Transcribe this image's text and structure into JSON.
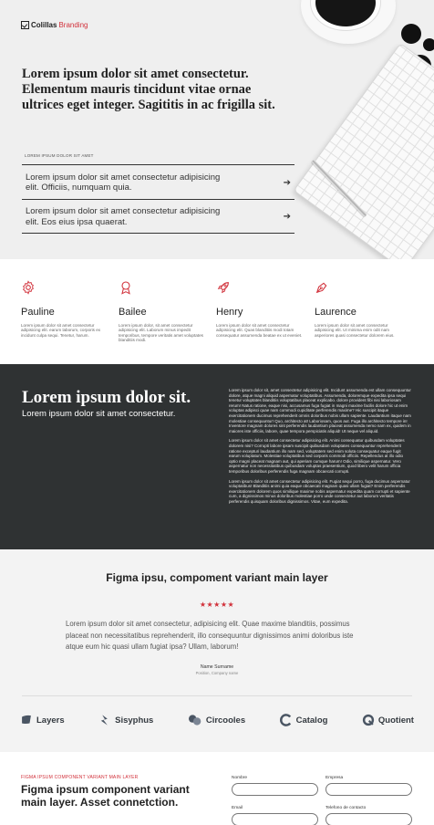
{
  "colors": {
    "accent": "#d1303a",
    "dark_section": "#2f3233",
    "light_bg": "#efefef"
  },
  "header": {
    "brand_part1": "Colillas",
    "brand_part2": "Branding"
  },
  "hero": {
    "title": "Lorem ipsum dolor sit amet consectetur. Elementum mauris tincidunt vitae ornae ultrices eget integer. Sagititis in ac frigilla sit.",
    "label": "LOREM IPSUM DOLOR SIT AMET",
    "links": [
      {
        "text": "Lorem ipsum dolor sit amet consectetur adipisicing elit. Officiis, numquam quia.",
        "icon": "arrow-right-icon"
      },
      {
        "text": "Lorem ipsum dolor sit amet consectetur adipisicing elit. Eos eius ipsa quaerat.",
        "icon": "arrow-right-icon"
      }
    ]
  },
  "features": [
    {
      "icon": "gear-icon",
      "name": "Pauline",
      "desc": "Lorem ipsum dolor sit amet consectetur adipisicing elit. earum laborum, corporis ex incidunt culpa sequi. Tenetur, harum."
    },
    {
      "icon": "award-ribbon-icon",
      "name": "Bailee",
      "desc": "Lorem ipsum dolor, sit amet consectetur adipisicing elit. Laborum minus impedit temporibus, tempore veritatis amet voluptates blanditiis modi."
    },
    {
      "icon": "rocket-icon",
      "name": "Henry",
      "desc": "Lorem ipsum dolor sit amet consectetur adipisicing elit. Quas blanditiis modi totam consequatur assumenda beatae ex ut eveniet."
    },
    {
      "icon": "pen-nib-icon",
      "name": "Laurence",
      "desc": "Lorem ipsum dolor sit amet consectetur adipisicing elit. Ut minima enim odit nam asperiores quasi consectetur dolorem eius."
    }
  ],
  "dark": {
    "title": "Lorem ipsum dolor sit.",
    "subtitle": "Lorem ipsum dolor sit amet consectetur.",
    "paragraphs": [
      "Lorem ipsum dolor sit, amet consectetur adipisicing elit. Incidunt assumenda est ullam consequuntur dolore, atque magni aliquid aspernatur voluptatibus. Assumenda, doloremque expedita ipsa sequi tenetur voluptates blanditiis voluptatibus placeat explicabo. dolore provident fibi nisi laboriosam rerum! Natus ratione, eaque nisi, accusamus fuga fugiat in magni maxime facilis dolore hic ut enim voluptas adipisci quae nam commodi cupiditate perferendis maxime? Hic suscipit itaque exercitationem ducimus reprehenderit omnis doloribus nobis ullam sapiente. Laudantium itaque nam molestiae consequuntur! Quo, architecto at! Laboriosam, quos aut. Fuga illo architecto tempore in! Inventore magnam dolores sint perferendis laudantium placeat assumenda nemo nam ex, quidem in maiores iste officiis, labore, quae tempora perspiciatis aliquid! Ut neque vel aliquid.",
      "Lorem ipsum dolor sit amet consectetur adipisicing elit. Animi consequatur quibusdam voluptates dolorem nisi? Corrupti labore ipsam suscipit quibusdam voluptates consequuntur reprehenderit ratione excepturi laudantium illo nam sed, voluptatem sed enim soluta consequatur eaque fugit earum voluptatum. Molestiae voluptatibus sed corporis commodi officiis. Repellendus at illo odio optio magni placeat magnam aut, qui aperiam cumque harum! Odio, similique aspernatur. Vero aspernatur non necessitatibus quibusdam voluptas praesentium, quod libero velit harum officia temporibus doloribus perferendis fuga magnam obcaecati corrupti.",
      "Lorem ipsum dolor sit amet consectetur adipisicing elit. Fugiat sequi porro, fuga ducimus aspernatur voluptatibus! Blanditiis animi quia eaque obcaecati magnam quasi ullam fugiat? Enim perferendis exercitationem dolorem quos similique maxime nobis aspernatur expedita quam corrupti et sapiente cum, a dignissimos minus doloribus molestiae porro unde consectetur aut laborum veritatis perferendis quisquam doloribus dignissimos. Vitae, eum expedita."
    ]
  },
  "testimonial": {
    "title": "Figma ipsu, compoment variant main layer",
    "stars": "★★★★★",
    "quote": "Lorem ipsum dolor sit amet consectetur, adipisicing elit. Quae maxime blanditiis, possimus placeat non necessitatibus reprehenderit, illo consequuntur dignissimos animi doloribus iste atque eum hic quasi ullam fugiat ipsa? Ullam, laborum!",
    "name": "Name Surname",
    "position": "Position, Company name"
  },
  "brands": [
    {
      "icon": "layers-logo-icon",
      "name": "Layers"
    },
    {
      "icon": "sisyphus-logo-icon",
      "name": "Sisyphus"
    },
    {
      "icon": "circooles-logo-icon",
      "name": "Circooles"
    },
    {
      "icon": "catalog-logo-icon",
      "name": "Catalog"
    },
    {
      "icon": "quotient-logo-icon",
      "name": "Quotient"
    }
  ],
  "contact": {
    "label": "FIGMA IPSUM COMPONENT VARIANT MAIN LAYER",
    "title": "Figma ipsum component variant main layer. Asset connetction.",
    "fields": {
      "name_label": "Nombre",
      "company_label": "Empresa",
      "email_label": "Email",
      "phone_label": "Telefono de contacto"
    }
  }
}
